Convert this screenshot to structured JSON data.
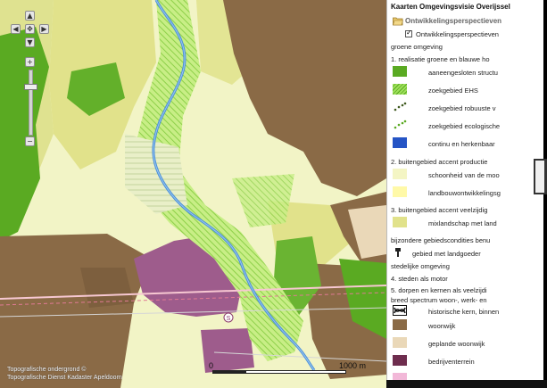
{
  "legend": {
    "title": "Kaarten Omgevingsvisie Overijssel",
    "layer": "Ontwikkelingsperspectieven",
    "checked_layer": "Ontwikkelingsperspectieven",
    "items": [
      {
        "text": "groene omgeving"
      },
      {
        "text": "1. realisatie groene en blauwe ho"
      },
      {
        "text": "aaneengesloten structu",
        "color": "#5aaa22"
      },
      {
        "text": "zoekgebied EHS",
        "color": "#9ee05a"
      },
      {
        "text": "zoekgebied robuuste v",
        "color": "#3f5a1f"
      },
      {
        "text": "zoekgebied ecologische",
        "color": "#5aaa22"
      },
      {
        "text": "continu en herkenbaar",
        "color": "#2554c5"
      },
      {
        "text": "2. buitengebied accent productie"
      },
      {
        "text": "schoonheid van de moo",
        "color": "#f4f5c4"
      },
      {
        "text": "landbouwontwikkelingsg",
        "color": "#fff9a8"
      },
      {
        "text": "3. buitengebied accent veelzijdig"
      },
      {
        "text": "mixlandschap met land",
        "color": "#e1e28b"
      },
      {
        "text": "bijzondere gebiedscondities benu"
      },
      {
        "text": "gebied met landgoeder"
      },
      {
        "text": "stedelijke omgeving"
      },
      {
        "text": "4. steden als motor"
      },
      {
        "text": "5. dorpen en kernen als veelzijdi"
      },
      {
        "text": "breed spectrum woon-, werk- en"
      },
      {
        "text": "historische kern, binnen"
      },
      {
        "text": "woonwijk",
        "color": "#8a6a46"
      },
      {
        "text": "geplande woonwijk",
        "color": "#ead8b8"
      },
      {
        "text": "bedrijventerrein",
        "color": "#6e2d4e"
      }
    ]
  },
  "map": {
    "attribution_line1": "Topografische ondergrond ©",
    "attribution_line2": "Topografische Dienst Kadaster Apeldoorn",
    "scale_zero": "0",
    "scale_max": "1000 m",
    "station_marker": "S",
    "colors": {
      "productie": "#f4f5c4",
      "mixlandschap": "#e1e28b",
      "groen": "#5aaa22",
      "woonwijk": "#8a6a46",
      "bedrijventerrein": "#9e5c8c",
      "rivier": "#4a90d9"
    }
  },
  "controls": {
    "pan_up": "▲",
    "pan_down": "▼",
    "pan_left": "◀",
    "pan_right": "▶",
    "pan_center": "✥",
    "zoom_in": "+",
    "zoom_out": "−"
  }
}
